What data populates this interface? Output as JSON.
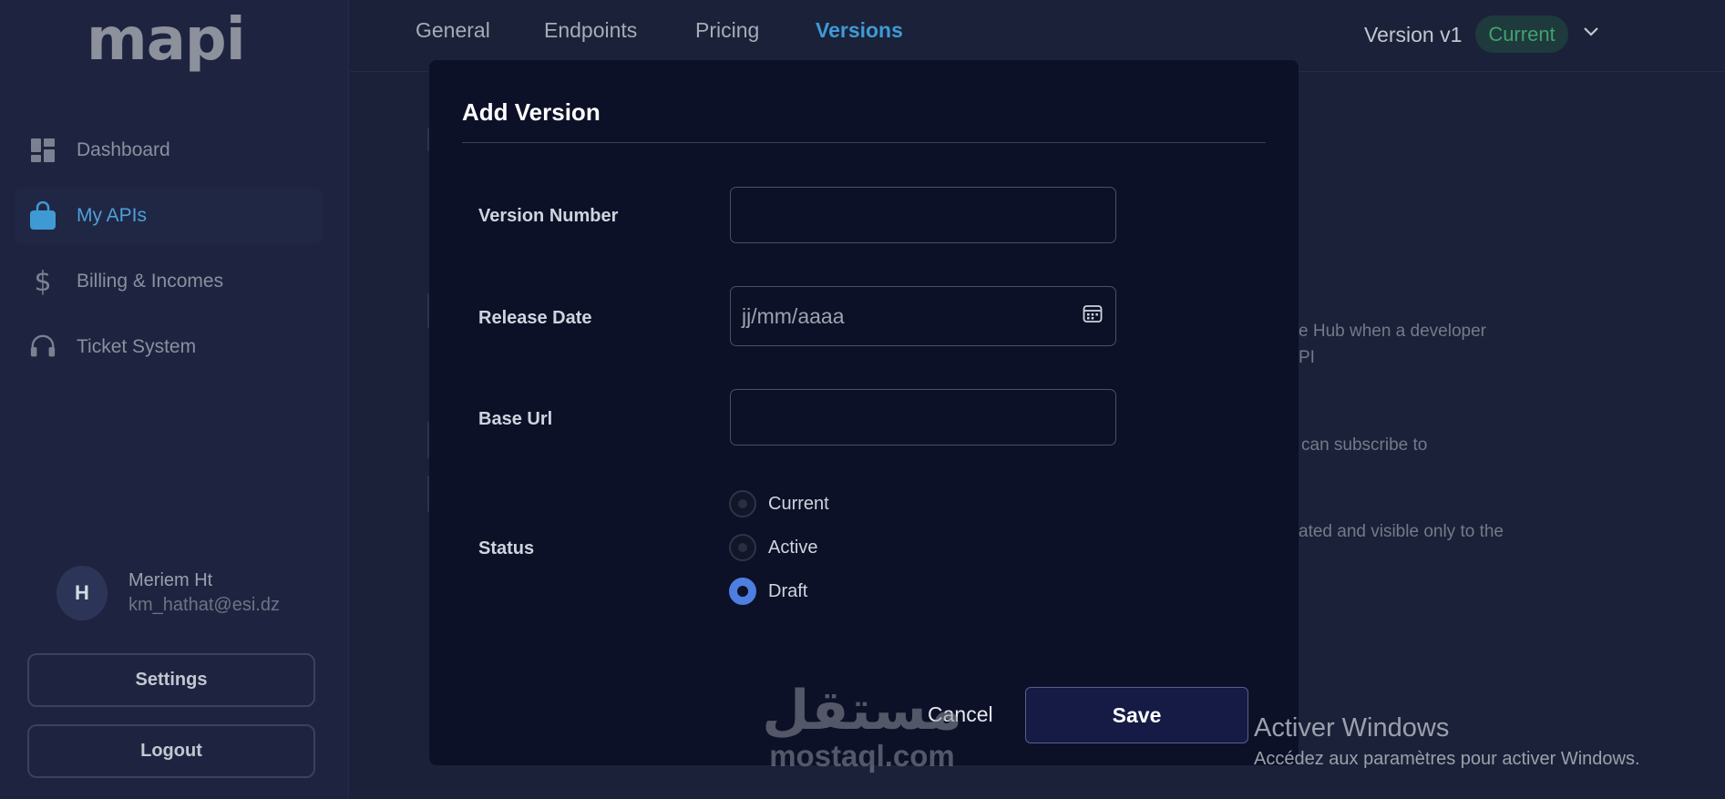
{
  "app": {
    "logo": "mapi"
  },
  "sidebar": {
    "items": [
      {
        "label": "Dashboard",
        "icon": "dashboard-icon",
        "active": false
      },
      {
        "label": "My APIs",
        "icon": "bag-icon",
        "active": true
      },
      {
        "label": "Billing & Incomes",
        "icon": "dollar-icon",
        "active": false
      },
      {
        "label": "Ticket System",
        "icon": "headset-icon",
        "active": false
      }
    ],
    "user": {
      "initial": "H",
      "name": "Meriem Ht",
      "email": "km_hathat@esi.dz"
    },
    "settings_label": "Settings",
    "logout_label": "Logout"
  },
  "topbar": {
    "tabs": [
      {
        "label": "General",
        "active": false
      },
      {
        "label": "Endpoints",
        "active": false
      },
      {
        "label": "Pricing",
        "active": false
      },
      {
        "label": "Versions",
        "active": true
      }
    ],
    "version_label": "Version v1",
    "version_badge": "Current"
  },
  "background": {
    "line1": "e Hub when a developer",
    "line2": "PI",
    "line3": "can subscribe to",
    "line4": "ated and visible only to the"
  },
  "modal": {
    "title": "Add Version",
    "fields": {
      "version_number": {
        "label": "Version Number",
        "value": ""
      },
      "release_date": {
        "label": "Release Date",
        "placeholder": "jj/mm/aaaa"
      },
      "base_url": {
        "label": "Base Url",
        "value": ""
      }
    },
    "status": {
      "label": "Status",
      "options": [
        {
          "label": "Current",
          "checked": false
        },
        {
          "label": "Active",
          "checked": false
        },
        {
          "label": "Draft",
          "checked": true
        }
      ]
    },
    "cancel_label": "Cancel",
    "save_label": "Save"
  },
  "watermarks": {
    "windows_title": "Activer Windows",
    "windows_sub": "Accédez aux paramètres pour activer Windows.",
    "mostaql_arabic": "مستقل",
    "mostaql_latin": "mostaql.com"
  },
  "colors": {
    "accent": "#3f9ad4",
    "radio_checked": "#4c7fe0",
    "badge_text": "#43a06d",
    "modal_bg": "#0c1128"
  }
}
